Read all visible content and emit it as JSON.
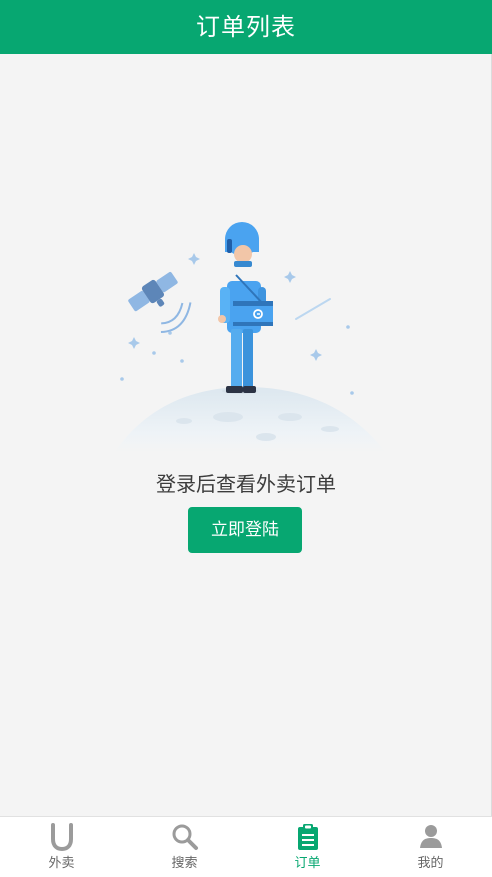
{
  "header": {
    "title": "订单列表"
  },
  "empty_state": {
    "illustration_icon": "astronaut-on-moon-icon",
    "message": "登录后查看外卖订单",
    "login_button_label": "立即登陆"
  },
  "tabbar": {
    "items": [
      {
        "label": "外卖",
        "icon": "takeout-u-icon",
        "active": false
      },
      {
        "label": "搜索",
        "icon": "search-icon",
        "active": false
      },
      {
        "label": "订单",
        "icon": "order-clipboard-icon",
        "active": true
      },
      {
        "label": "我的",
        "icon": "user-icon",
        "active": false
      }
    ]
  },
  "colors": {
    "primary": "#07a771",
    "background": "#f4f4f4",
    "inactive_tab": "#9b9b9b",
    "astronaut_blue": "#4aa3f0"
  }
}
